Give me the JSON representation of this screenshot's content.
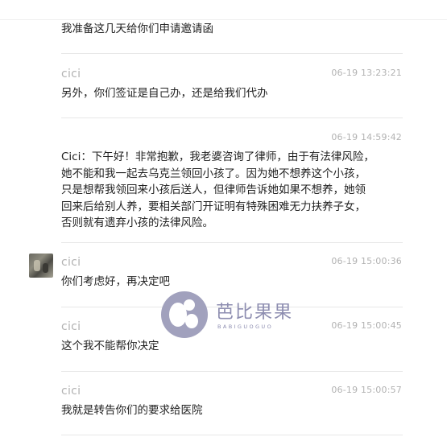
{
  "messages": [
    {
      "sender": "",
      "time": "",
      "text": "我准备这几天给你们申请邀请函"
    },
    {
      "sender": "cici",
      "time": "06-19 13:23:21",
      "text": "另外，你们签证是自己办，还是给我们代办"
    },
    {
      "sender": "",
      "time": "06-19 14:59:42",
      "text": "Cici：下午好！非常抱歉，我老婆咨询了律师，由于有法律风险，\n她不能和我一起去乌克兰领回小孩了。因为她不想养这个小孩，\n只是想帮我领回来小孩后送人，但律师告诉她如果不想养，她领\n回来后给别人养，要相关部门开证明有特殊困难无力扶养子女，\n否则就有遗弃小孩的法律风险。"
    },
    {
      "sender": "cici",
      "time": "06-19 15:00:36",
      "text": "你们考虑好，再决定吧",
      "avatar": "user-avatar-photo"
    },
    {
      "sender": "cici",
      "time": "06-19 15:00:45",
      "text": "这个我不能帮你决定"
    },
    {
      "sender": "cici",
      "time": "06-19 15:00:57",
      "text": "我就是转告你们的要求给医院"
    }
  ],
  "watermark": {
    "title": "芭比果果",
    "subtitle": "BABIGUOGUO",
    "color": "#9a9ab8"
  },
  "colors": {
    "sender": "#b2b2b2",
    "time": "#b2b2b2",
    "text": "#222222",
    "divider": "#e7e7e7"
  }
}
